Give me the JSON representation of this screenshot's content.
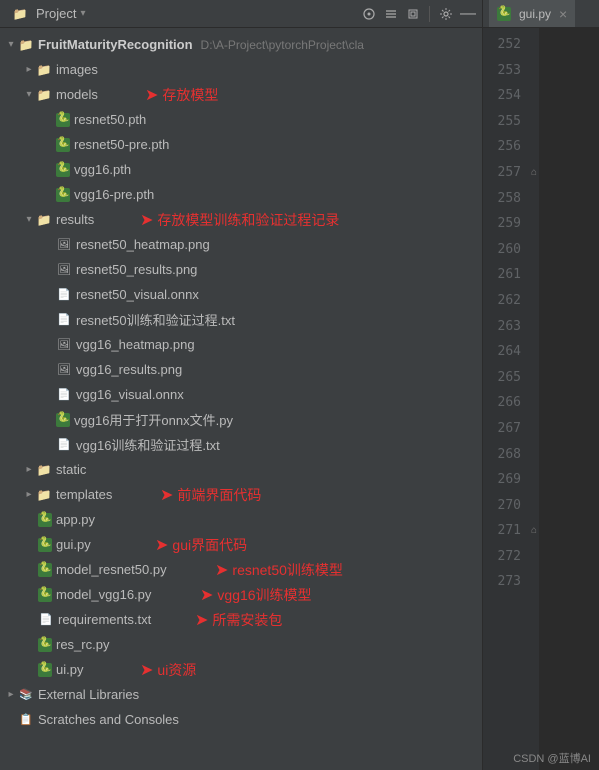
{
  "toolbar": {
    "project_label": "Project"
  },
  "tab": {
    "filename": "gui.py"
  },
  "tree": {
    "root": {
      "name": "FruitMaturityRecognition",
      "path": "D:\\A-Project\\pytorchProject\\cla"
    },
    "images": "images",
    "models": {
      "name": "models",
      "annotation": "存放模型",
      "files": [
        "resnet50.pth",
        "resnet50-pre.pth",
        "vgg16.pth",
        "vgg16-pre.pth"
      ]
    },
    "results": {
      "name": "results",
      "annotation": "存放模型训练和验证过程记录",
      "files": [
        "resnet50_heatmap.png",
        "resnet50_results.png",
        "resnet50_visual.onnx",
        "resnet50训练和验证过程.txt",
        "vgg16_heatmap.png",
        "vgg16_results.png",
        "vgg16_visual.onnx",
        "vgg16用于打开onnx文件.py",
        "vgg16训练和验证过程.txt"
      ]
    },
    "static": "static",
    "templates": {
      "name": "templates",
      "annotation": "前端界面代码"
    },
    "root_files": {
      "app": {
        "name": "app.py"
      },
      "gui": {
        "name": "gui.py",
        "annotation": "gui界面代码"
      },
      "model_resnet50": {
        "name": "model_resnet50.py",
        "annotation": "resnet50训练模型"
      },
      "model_vgg16": {
        "name": "model_vgg16.py",
        "annotation": "vgg16训练模型"
      },
      "requirements": {
        "name": "requirements.txt",
        "annotation": "所需安装包"
      },
      "res_rc": {
        "name": "res_rc.py"
      },
      "ui": {
        "name": "ui.py",
        "annotation": "ui资源"
      }
    },
    "external_libs": "External Libraries",
    "scratches": "Scratches and Consoles"
  },
  "line_numbers": [
    252,
    253,
    254,
    255,
    256,
    257,
    258,
    259,
    260,
    261,
    262,
    263,
    264,
    265,
    266,
    267,
    268,
    269,
    270,
    271,
    272,
    273
  ],
  "watermark": "CSDN @蓝博AI"
}
